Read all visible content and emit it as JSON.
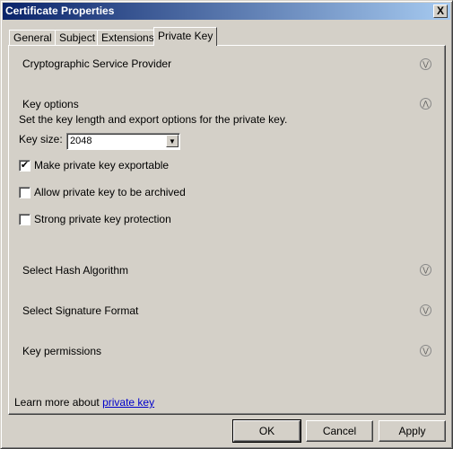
{
  "window": {
    "title": "Certificate Properties",
    "close_label": "X"
  },
  "tabs": [
    {
      "label": "General"
    },
    {
      "label": "Subject"
    },
    {
      "label": "Extensions"
    },
    {
      "label": "Private Key",
      "active": true
    }
  ],
  "sections": {
    "csp": {
      "label": "Cryptographic Service Provider",
      "icon": "chevron-down-circle-icon"
    },
    "key_options": {
      "label": "Key options",
      "icon": "chevron-up-circle-icon",
      "description": "Set the key length and export options for the private key.",
      "key_size_label": "Key size:",
      "key_size_value": "2048",
      "checkboxes": [
        {
          "label": "Make private key exportable",
          "checked": true
        },
        {
          "label": "Allow private key to be archived",
          "checked": false
        },
        {
          "label": "Strong private key protection",
          "checked": false
        }
      ]
    },
    "hash": {
      "label": "Select Hash Algorithm"
    },
    "signature": {
      "label": "Select Signature Format"
    },
    "permissions": {
      "label": "Key permissions"
    }
  },
  "footer": {
    "learn_more": "Learn more about",
    "link": "private key"
  },
  "buttons": {
    "ok": "OK",
    "cancel": "Cancel",
    "apply": "Apply"
  },
  "colors": {
    "title_start": "#0a246a",
    "title_end": "#a6caf0",
    "link": "#0000cc"
  }
}
